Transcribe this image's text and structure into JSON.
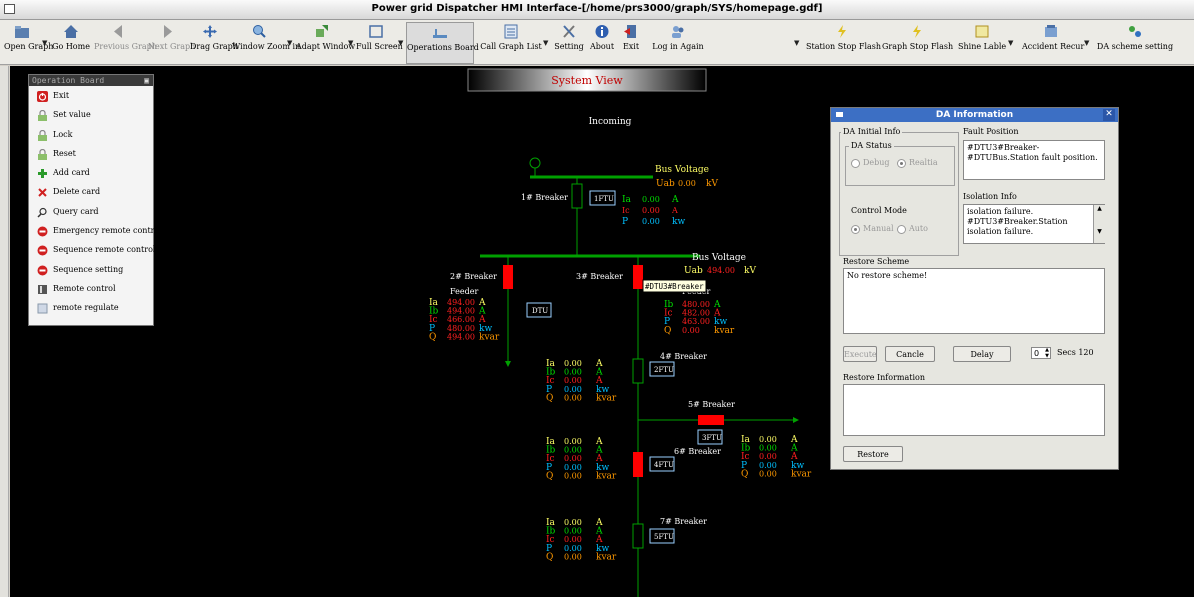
{
  "window": {
    "title": "Power grid Dispatcher HMI Interface-[/home/prs3000/graph/SYS/homepage.gdf]"
  },
  "toolbar": {
    "open_graph": "Open Graph",
    "go_home": "Go Home",
    "previous_graph": "Previous Graph",
    "next_graph": "Next Graph",
    "drag_graph": "Drag Graph",
    "window_zoom_in": "Window Zoom in",
    "adapt_window": "Adapt Window",
    "full_screen": "Full Screen",
    "operations_board": "Operations Board",
    "call_graph_list": "Call Graph List",
    "setting": "Setting",
    "about": "About",
    "exit": "Exit",
    "login_again": "Log in Again",
    "station_stop_flash": "Station Stop Flash",
    "graph_stop_flash": "Graph Stop Flash",
    "shine_lable": "Shine Lable",
    "accident_recur": "Accident Recur",
    "da_scheme_setting": "DA scheme setting"
  },
  "op_board": {
    "title": "Operation Board",
    "items": [
      {
        "label": "Exit",
        "icon": "power-icon"
      },
      {
        "label": "Set value",
        "icon": "lock-icon"
      },
      {
        "label": "Lock",
        "icon": "lock-icon"
      },
      {
        "label": "Reset",
        "icon": "lock-icon"
      },
      {
        "label": "Add card",
        "icon": "plus-icon"
      },
      {
        "label": "Delete card",
        "icon": "cross-icon"
      },
      {
        "label": "Query card",
        "icon": "magnifier-icon"
      },
      {
        "label": "Emergency remote control",
        "icon": "stop-icon"
      },
      {
        "label": "Sequence remote control",
        "icon": "stop-icon"
      },
      {
        "label": "Sequence setting",
        "icon": "stop-icon"
      },
      {
        "label": "Remote control",
        "icon": "switch-icon"
      },
      {
        "label": "remote regulate",
        "icon": "regulate-icon"
      }
    ]
  },
  "diagram": {
    "title": "System View",
    "incoming": "Incoming",
    "bus1": {
      "label": "Bus Voltage",
      "uab_label": "Uab",
      "uab_value": "0.00",
      "unit": "kV"
    },
    "bus2": {
      "label": "Bus Voltage",
      "uab_label": "Uab",
      "uab_value": "494.00",
      "unit": "kV"
    },
    "breaker1": {
      "label": "1# Breaker",
      "ftu": "1FTU",
      "ia_label": "Ia",
      "ia": "0.00",
      "ia_unit": "A",
      "ic_label": "Ic",
      "ic": "0.00",
      "ic_unit": "A",
      "p_label": "P",
      "p": "0.00",
      "p_unit": "kw"
    },
    "breaker2": {
      "label": "2# Breaker",
      "feeder": "Feeder",
      "dtu": "DTU",
      "rows": [
        {
          "label": "Ia",
          "value": "494.00",
          "unit": "A"
        },
        {
          "label": "Ib",
          "value": "494.00",
          "unit": "A"
        },
        {
          "label": "Ic",
          "value": "466.00",
          "unit": "A"
        },
        {
          "label": "P",
          "value": "480.00",
          "unit": "kw"
        },
        {
          "label": "Q",
          "value": "494.00",
          "unit": "kvar"
        }
      ]
    },
    "breaker3": {
      "label": "3# Breaker",
      "feeder": "Feeder",
      "tooltip": "#DTU3#Breaker",
      "rows": [
        {
          "label": "Ib",
          "value": "480.00",
          "unit": "A"
        },
        {
          "label": "Ic",
          "value": "482.00",
          "unit": "A"
        },
        {
          "label": "P",
          "value": "463.00",
          "unit": "kw"
        },
        {
          "label": "Q",
          "value": "0.00",
          "unit": "kvar"
        }
      ]
    },
    "breaker4": {
      "label": "4# Breaker",
      "ftu": "2FTU"
    },
    "breaker5": {
      "label": "5# Breaker",
      "ftu": "3FTU"
    },
    "breaker6": {
      "label": "6# Breaker",
      "ftu": "4FTU"
    },
    "breaker7": {
      "label": "7# Breaker",
      "ftu": "5FTU"
    },
    "zero_rows": [
      {
        "label": "Ia",
        "value": "0.00",
        "unit": "A"
      },
      {
        "label": "Ib",
        "value": "0.00",
        "unit": "A"
      },
      {
        "label": "Ic",
        "value": "0.00",
        "unit": "A"
      },
      {
        "label": "P",
        "value": "0.00",
        "unit": "kw"
      },
      {
        "label": "Q",
        "value": "0.00",
        "unit": "kvar"
      }
    ]
  },
  "da_window": {
    "title": "DA Information",
    "initial_info": "DA Initial Info",
    "da_status": "DA Status",
    "debug": "Debug",
    "realtime": "Realtia",
    "fault_position": "Fault Position",
    "fault_text": "#DTU3#Breaker- #DTUBus.Station fault position.",
    "isolation_info": "Isolation Info",
    "isolation_text": "isolation failure. #DTU3#Breaker.Station isolation failure.",
    "control_mode": "Control Mode",
    "manual": "Manual",
    "auto": "Auto",
    "restore_scheme": "Restore Scheme",
    "restore_scheme_text": "No restore scheme!",
    "execute": "Execute",
    "cancle": "Cancle",
    "delay": "Delay",
    "spin_value": "0",
    "secs": "Secs 120",
    "restore_information": "Restore Information",
    "restore": "Restore"
  },
  "colors": {
    "live_line": "#00a000",
    "breaker_closed": "#ff0000",
    "label_yellow": "#ffff66",
    "label_green": "#00dd00",
    "label_red": "#ff2020",
    "label_blue": "#00c0ff",
    "label_orange": "#ff9900"
  }
}
